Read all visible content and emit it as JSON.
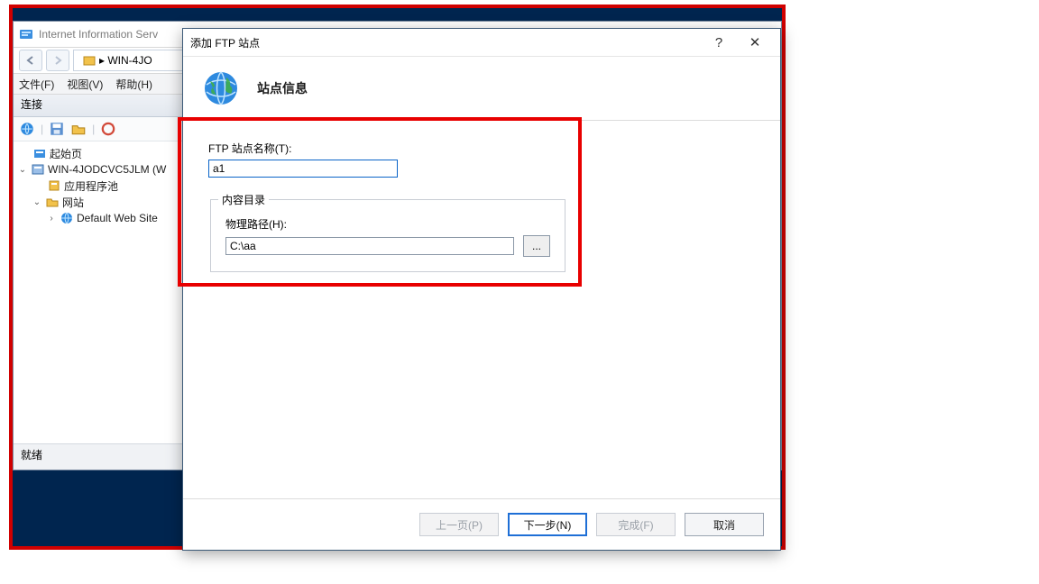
{
  "iis": {
    "title": "Internet Information Serv",
    "breadcrumb_prefix": "▸  WIN-4JO",
    "menu": {
      "file": "文件(F)",
      "view": "视图(V)",
      "help": "帮助(H)"
    },
    "connections_header": "连接",
    "tree": {
      "start_page": "起始页",
      "server": "WIN-4JODCVC5JLM (W",
      "app_pools": "应用程序池",
      "sites": "网站",
      "default_site": "Default Web Site"
    },
    "status": "就绪"
  },
  "dialog": {
    "title": "添加 FTP 站点",
    "help_glyph": "?",
    "close_glyph": "✕",
    "header": "站点信息",
    "site_name_label": "FTP 站点名称(T):",
    "site_name_value": "a1",
    "content_group": "内容目录",
    "phys_path_label": "物理路径(H):",
    "phys_path_value": "C:\\aa",
    "browse_label": "...",
    "buttons": {
      "prev": "上一页(P)",
      "next": "下一步(N)",
      "finish": "完成(F)",
      "cancel": "取消"
    }
  }
}
